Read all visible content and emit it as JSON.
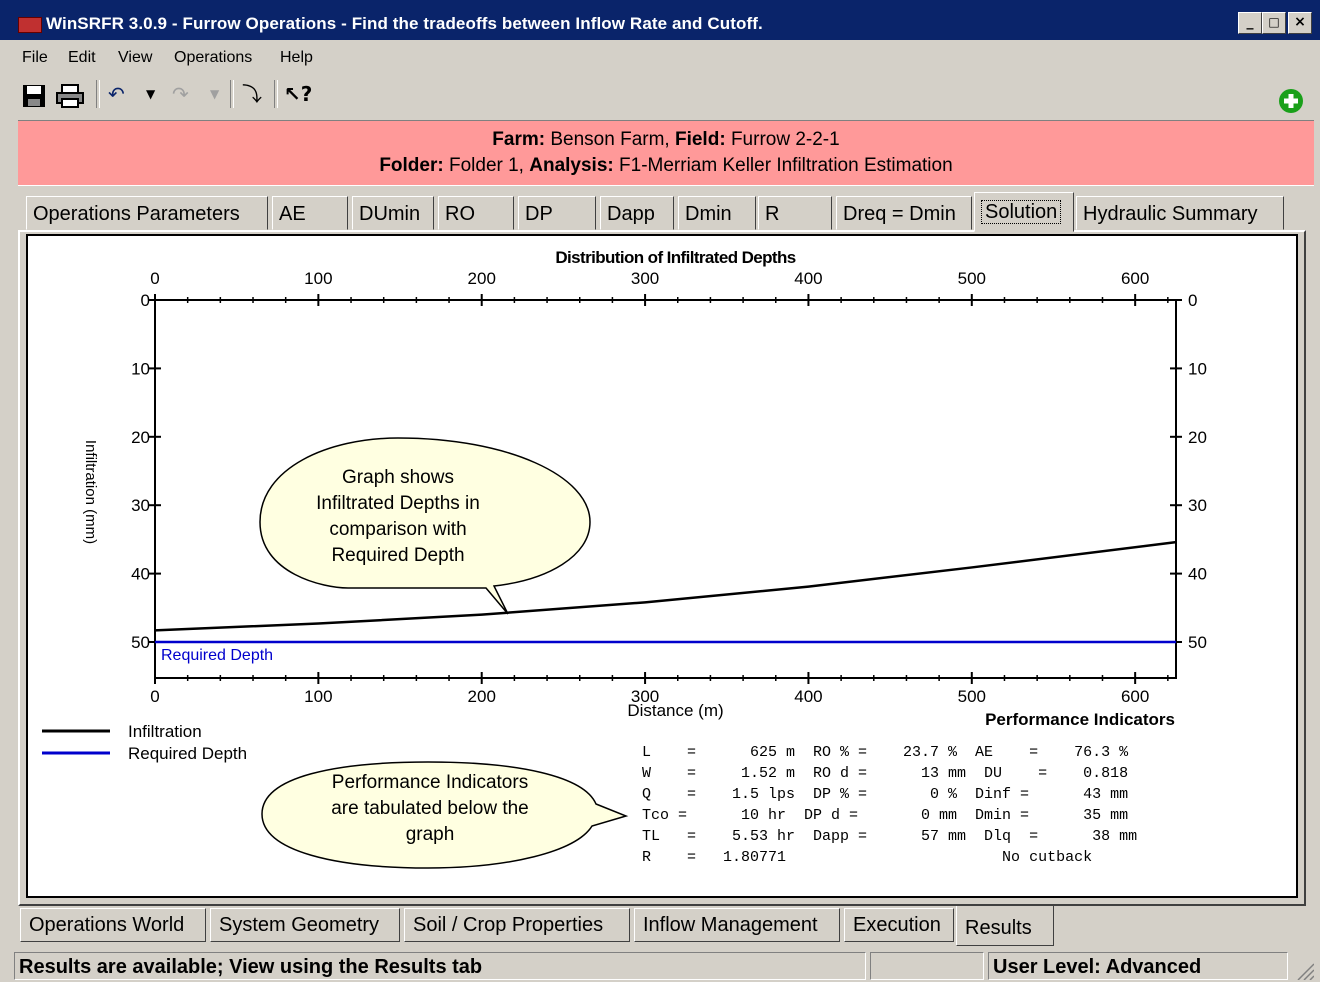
{
  "window": {
    "title": "WinSRFR 3.0.9 - Furrow Operations - Find the tradeoffs between Inflow Rate and Cutoff.",
    "controls": {
      "minimize": "_",
      "maximize": "□",
      "close": "×"
    }
  },
  "menu": [
    "File",
    "Edit",
    "View",
    "Operations",
    "Help"
  ],
  "toolbar": {
    "icons": [
      "save-icon",
      "print-icon",
      "undo-icon",
      "undo-dropdown-icon",
      "redo-icon",
      "redo-dropdown-icon",
      "wizard-icon",
      "whats-this-help-icon",
      "add-icon"
    ]
  },
  "header": {
    "farm_label": "Farm:",
    "farm_value": "Benson Farm,",
    "field_label": "Field:",
    "field_value": "Furrow 2-2-1",
    "folder_label": "Folder:",
    "folder_value": "Folder 1,",
    "analysis_label": "Analysis:",
    "analysis_value": "F1-Merriam Keller Infiltration Estimation",
    "background_color": "#ff9999"
  },
  "top_tabs": [
    "Operations Parameters",
    "AE",
    "DUmin",
    "RO",
    "DP",
    "Dapp",
    "Dmin",
    "R",
    "Dreq = Dmin",
    "Solution",
    "Hydraulic Summary"
  ],
  "active_top_tab": "Solution",
  "chart_data": {
    "type": "line",
    "title": "Distribution of Infiltrated Depths",
    "xlabel": "Distance (m)",
    "ylabel": "Infiltration (mm)",
    "xlim": [
      0,
      625
    ],
    "ylim": [
      0,
      52
    ],
    "y_inverted": true,
    "x_ticks": [
      0,
      100,
      200,
      300,
      400,
      500,
      600
    ],
    "y_ticks": [
      0,
      10,
      20,
      30,
      40,
      50
    ],
    "series": [
      {
        "name": "Infiltration",
        "color": "#000000",
        "x": [
          0,
          100,
          200,
          300,
          400,
          500,
          625
        ],
        "y": [
          48.3,
          47.3,
          46.0,
          44.2,
          41.9,
          39.1,
          35.4
        ]
      },
      {
        "name": "Required Depth",
        "color": "#0000cc",
        "x": [
          0,
          625
        ],
        "y": [
          50,
          50
        ]
      }
    ],
    "annotations": [
      "Required Depth"
    ],
    "legend_position": "bottom-left"
  },
  "callouts": {
    "graph": [
      "Graph shows",
      "Infiltrated Depths in",
      "comparison with",
      "Required Depth"
    ],
    "indicators": [
      "Performance Indicators",
      "are tabulated below the",
      "graph"
    ]
  },
  "performance": {
    "title": "Performance Indicators",
    "rows": [
      "L    =      625 m  RO % =    23.7 %  AE    =    76.3 %",
      "W    =     1.52 m  RO d =      13 mm  DU    =    0.818",
      "Q    =    1.5 lps  DP % =       0 %  Dinf =      43 mm",
      "Tco =      10 hr  DP d =       0 mm  Dmin =      35 mm",
      "TL   =    5.53 hr  Dapp =      57 mm  Dlq  =      38 mm",
      "R    =   1.80771                        No cutback"
    ]
  },
  "bottom_tabs": [
    "Operations World",
    "System Geometry",
    "Soil / Crop Properties",
    "Inflow Management",
    "Execution",
    "Results"
  ],
  "active_bottom_tab": "Results",
  "status": {
    "message": "Results are available; View using the Results tab",
    "middle": "",
    "user_level": "User Level:  Advanced"
  }
}
